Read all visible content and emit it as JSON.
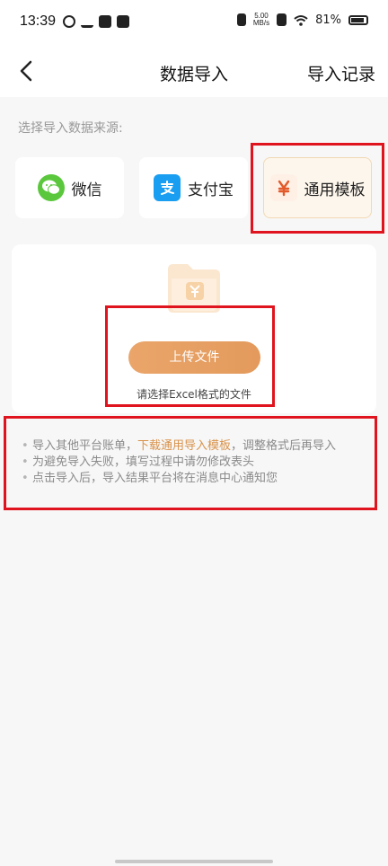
{
  "status_bar": {
    "time": "13:39",
    "net_speed_value": "5.00",
    "net_speed_unit": "MB/s",
    "battery": "81%"
  },
  "header": {
    "title": "数据导入",
    "right_action": "导入记录"
  },
  "section_label": "选择导入数据来源:",
  "sources": [
    {
      "label": "微信",
      "icon": "wechat-icon",
      "selected": false
    },
    {
      "label": "支付宝",
      "icon": "alipay-icon",
      "selected": false
    },
    {
      "label": "通用模板",
      "icon": "template-yen-icon",
      "selected": true
    }
  ],
  "upload": {
    "button_label": "上传文件",
    "hint": "请选择Excel格式的文件"
  },
  "notes": [
    {
      "prefix": "导入其他平台账单，",
      "link": "下载通用导入模板",
      "suffix": "，调整格式后再导入"
    },
    {
      "text": "为避免导入失败，填写过程中请勿修改表头"
    },
    {
      "text": "点击导入后，导入结果平台将在消息中心通知您"
    }
  ],
  "colors": {
    "accent": "#e39a5c",
    "link": "#d9924a",
    "highlight_box": "#e0141e",
    "wechat": "#5ac73c",
    "alipay": "#1a9ef1"
  }
}
